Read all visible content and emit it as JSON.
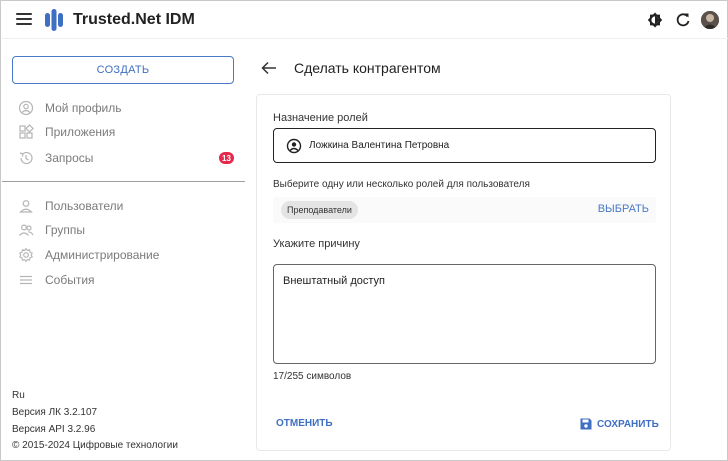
{
  "header": {
    "app_title": "Trusted.Net IDM",
    "icons": [
      "menu-icon",
      "app-logo",
      "theme-toggle-icon",
      "refresh-icon",
      "user-avatar"
    ]
  },
  "sidebar": {
    "create_label": "СОЗДАТЬ",
    "items_top": [
      {
        "label": "Мой профиль",
        "icon": "profile-icon"
      },
      {
        "label": "Приложения",
        "icon": "apps-icon"
      },
      {
        "label": "Запросы",
        "icon": "history-icon",
        "badge": "13"
      }
    ],
    "items_bottom": [
      {
        "label": "Пользователи",
        "icon": "user-icon"
      },
      {
        "label": "Группы",
        "icon": "groups-icon"
      },
      {
        "label": "Администрирование",
        "icon": "settings-icon"
      },
      {
        "label": "События",
        "icon": "events-icon"
      }
    ],
    "footer": {
      "language": "Ru",
      "version_lk": "Версия ЛК 3.2.107",
      "version_api": "Версия API 3.2.96",
      "copyright": "© 2015-2024 Цифровые технологии"
    }
  },
  "main": {
    "title": "Сделать контрагентом",
    "role_assignment_label": "Назначение ролей",
    "selected_user": "Ложкина Валентина Петровна",
    "roles_label": "Выберите одну или несколько ролей для пользователя",
    "selected_role_chip": "Преподаватели",
    "select_button": "ВЫБРАТЬ",
    "reason_label": "Укажите причину",
    "reason_value": "Внештатный доступ",
    "char_counter": "17/255 символов",
    "cancel_button": "ОТМЕНИТЬ",
    "save_button": "СОХРАНИТЬ"
  },
  "colors": {
    "accent": "#3f6fc2",
    "badge": "#e5284b",
    "logo": "#3f6fc2"
  }
}
